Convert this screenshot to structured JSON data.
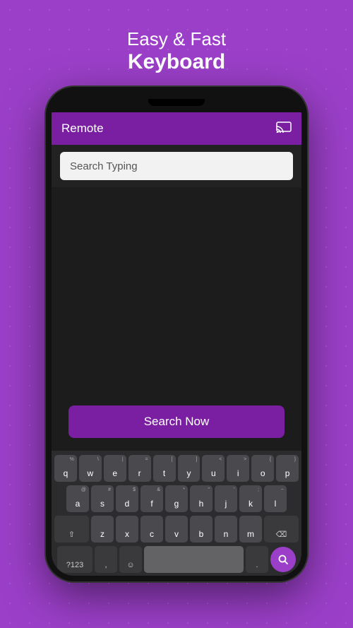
{
  "header": {
    "line1": "Easy & Fast",
    "line2": "Keyboard"
  },
  "appBar": {
    "title": "Remote",
    "castIconLabel": "cast"
  },
  "searchBar": {
    "placeholder": "Search Typing"
  },
  "searchButton": {
    "label": "Search Now"
  },
  "keyboard": {
    "row1": [
      {
        "key": "q",
        "sub": "%"
      },
      {
        "key": "w",
        "sub": "\\"
      },
      {
        "key": "e",
        "sub": "|"
      },
      {
        "key": "r",
        "sub": "="
      },
      {
        "key": "t",
        "sub": "["
      },
      {
        "key": "y",
        "sub": "]"
      },
      {
        "key": "u",
        "sub": "<"
      },
      {
        "key": "i",
        "sub": ">"
      },
      {
        "key": "o",
        "sub": "{"
      },
      {
        "key": "p",
        "sub": "}"
      }
    ],
    "row2": [
      {
        "key": "a",
        "sub": "@"
      },
      {
        "key": "s",
        "sub": "#"
      },
      {
        "key": "d",
        "sub": "$"
      },
      {
        "key": "f",
        "sub": "&"
      },
      {
        "key": "g",
        "sub": "*"
      },
      {
        "key": "h",
        "sub": "\""
      },
      {
        "key": "j",
        "sub": "'"
      },
      {
        "key": "k",
        "sub": ";"
      },
      {
        "key": "l",
        "sub": "~"
      }
    ],
    "row3": [
      {
        "key": "z"
      },
      {
        "key": "x"
      },
      {
        "key": "c"
      },
      {
        "key": "v"
      },
      {
        "key": "b"
      },
      {
        "key": "n"
      },
      {
        "key": "m"
      }
    ],
    "bottomLeft": "?123",
    "bottomRight": "."
  }
}
